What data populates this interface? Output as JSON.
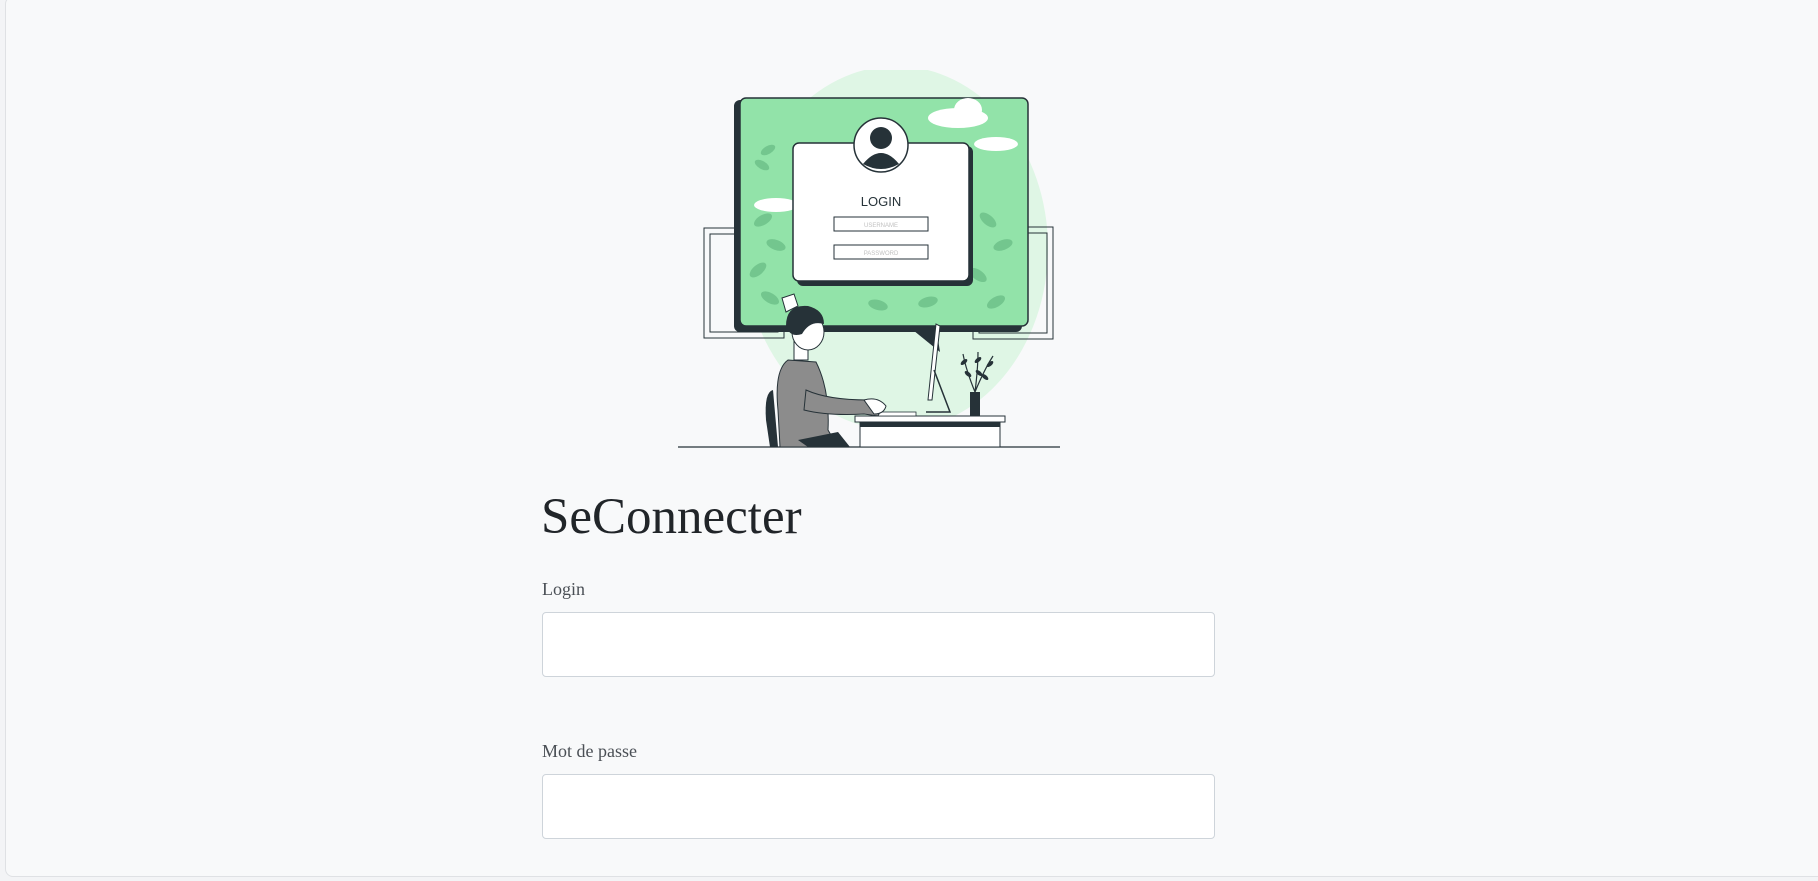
{
  "page": {
    "title": "SeConnecter"
  },
  "illustration": {
    "card_title": "LOGIN",
    "username_placeholder": "USERNAME",
    "password_placeholder": "PASSWORD"
  },
  "form": {
    "login_label": "Login",
    "login_value": "",
    "password_label": "Mot de passe",
    "password_value": ""
  },
  "colors": {
    "accent_green": "#92e3a9",
    "light_green": "#dff6e5",
    "dark": "#263238",
    "background": "#f8f9fa"
  }
}
